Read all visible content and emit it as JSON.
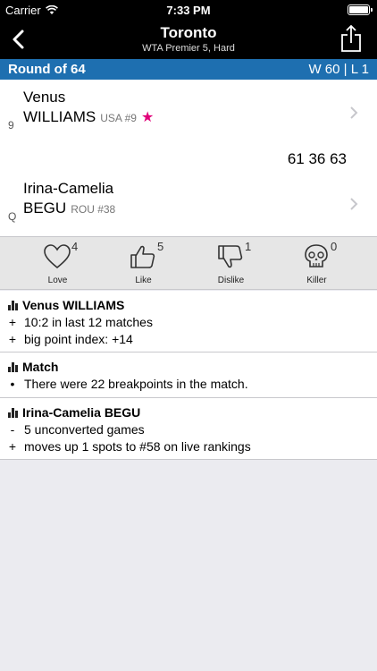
{
  "status": {
    "carrier": "Carrier",
    "time": "7:33 PM"
  },
  "nav": {
    "title": "Toronto",
    "subtitle": "WTA Premier 5, Hard"
  },
  "round": {
    "label": "Round of 64",
    "record": "W 60 | L 1"
  },
  "players": [
    {
      "first": "Venus",
      "last": "WILLIAMS",
      "seed": "9",
      "info": "USA #9",
      "favorite": true
    },
    {
      "first": "Irina-Camelia",
      "last": "BEGU",
      "seed": "Q",
      "info": "ROU #38",
      "favorite": false
    }
  ],
  "score": "61 36 63",
  "reactions": [
    {
      "label": "Love",
      "count": "4",
      "icon": "heart-icon"
    },
    {
      "label": "Like",
      "count": "5",
      "icon": "thumbs-up-icon"
    },
    {
      "label": "Dislike",
      "count": "1",
      "icon": "thumbs-down-icon"
    },
    {
      "label": "Killer",
      "count": "0",
      "icon": "skull-icon"
    }
  ],
  "sections": [
    {
      "title": "Venus WILLIAMS",
      "lines": [
        {
          "bullet": "+",
          "text": "10:2 in last 12 matches"
        },
        {
          "bullet": "+",
          "text": "big point index: +14"
        }
      ]
    },
    {
      "title": "Match",
      "lines": [
        {
          "bullet": "•",
          "text": "There were 22 breakpoints in the match."
        }
      ]
    },
    {
      "title": "Irina-Camelia BEGU",
      "lines": [
        {
          "bullet": "-",
          "text": "5 unconverted games"
        },
        {
          "bullet": "+",
          "text": "moves up 1 spots to #58 on live rankings"
        }
      ]
    }
  ],
  "colors": {
    "accent": "#1e6fb0",
    "star": "#e1007a",
    "navbar": "#000000"
  }
}
